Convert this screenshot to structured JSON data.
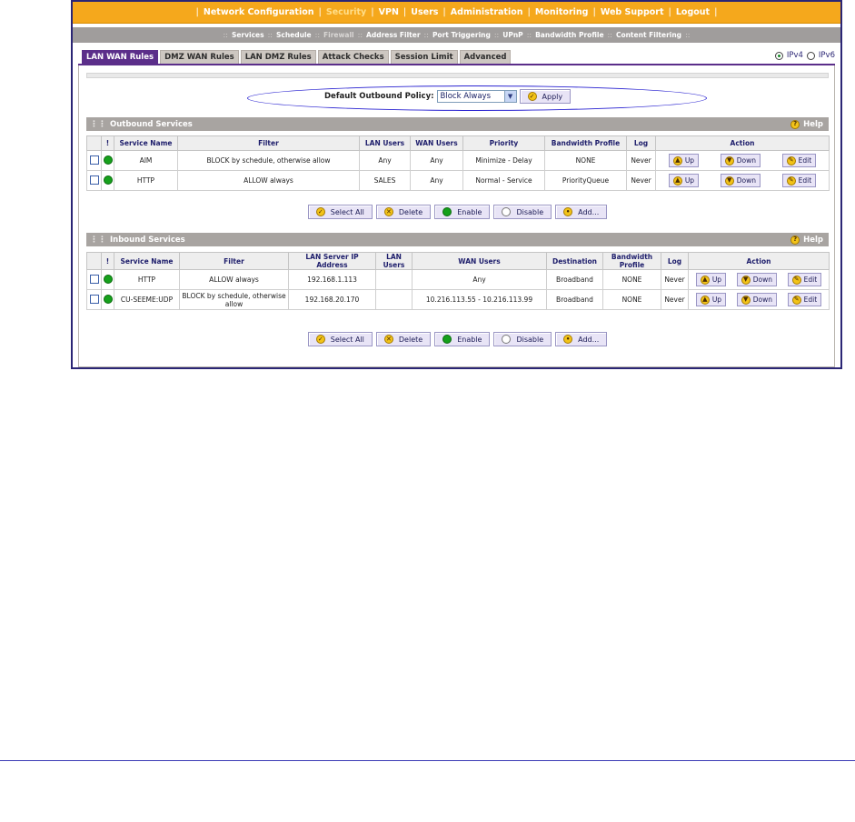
{
  "topnav": {
    "items": [
      "Network Configuration",
      "Security",
      "VPN",
      "Users",
      "Administration",
      "Monitoring",
      "Web Support",
      "Logout"
    ],
    "active_index": 1,
    "separator": "|"
  },
  "subnav": {
    "items": [
      "Services",
      "Schedule",
      "Firewall",
      "Address Filter",
      "Port Triggering",
      "UPnP",
      "Bandwidth Profile",
      "Content Filtering"
    ],
    "active_index": 2,
    "separator": "::"
  },
  "tabs": [
    "LAN WAN Rules",
    "DMZ WAN Rules",
    "LAN DMZ Rules",
    "Attack Checks",
    "Session Limit",
    "Advanced"
  ],
  "active_tab": 0,
  "ip_version": {
    "ipv4": "IPv4",
    "ipv6": "IPv6",
    "selected": "IPv4"
  },
  "policy": {
    "label": "Default Outbound Policy:",
    "value": "Block Always",
    "apply": "Apply"
  },
  "outbound": {
    "title": "Outbound Services",
    "help": "Help",
    "columns": [
      "!",
      "Service Name",
      "Filter",
      "LAN Users",
      "WAN Users",
      "Priority",
      "Bandwidth Profile",
      "Log",
      "Action"
    ],
    "rows": [
      {
        "service": "AIM",
        "filter": "BLOCK by schedule, otherwise allow",
        "lan_users": "Any",
        "wan_users": "Any",
        "priority": "Minimize - Delay",
        "bandwidth": "NONE",
        "log": "Never"
      },
      {
        "service": "HTTP",
        "filter": "ALLOW always",
        "lan_users": "SALES",
        "wan_users": "Any",
        "priority": "Normal - Service",
        "bandwidth": "PriorityQueue",
        "log": "Never"
      }
    ]
  },
  "inbound": {
    "title": "Inbound Services",
    "help": "Help",
    "columns": [
      "!",
      "Service Name",
      "Filter",
      "LAN Server IP Address",
      "LAN Users",
      "WAN Users",
      "Destination",
      "Bandwidth Profile",
      "Log",
      "Action"
    ],
    "rows": [
      {
        "service": "HTTP",
        "filter": "ALLOW always",
        "lan_ip": "192.168.1.113",
        "lan_users": "",
        "wan_users": "Any",
        "destination": "Broadband",
        "bandwidth": "NONE",
        "log": "Never"
      },
      {
        "service": "CU-SEEME:UDP",
        "filter": "BLOCK by schedule, otherwise allow",
        "lan_ip": "192.168.20.170",
        "lan_users": "",
        "wan_users": "10.216.113.55 - 10.216.113.99",
        "destination": "Broadband",
        "bandwidth": "NONE",
        "log": "Never"
      }
    ]
  },
  "row_actions": {
    "up": "Up",
    "down": "Down",
    "edit": "Edit"
  },
  "bulk_actions": {
    "select_all": "Select All",
    "delete": "Delete",
    "enable": "Enable",
    "disable": "Disable",
    "add": "Add..."
  },
  "colors": {
    "nav_orange": "#f5a81c",
    "tab_purple": "#5b2e8a",
    "section_gray": "#a8a4a1",
    "status_green": "#16a11c"
  }
}
